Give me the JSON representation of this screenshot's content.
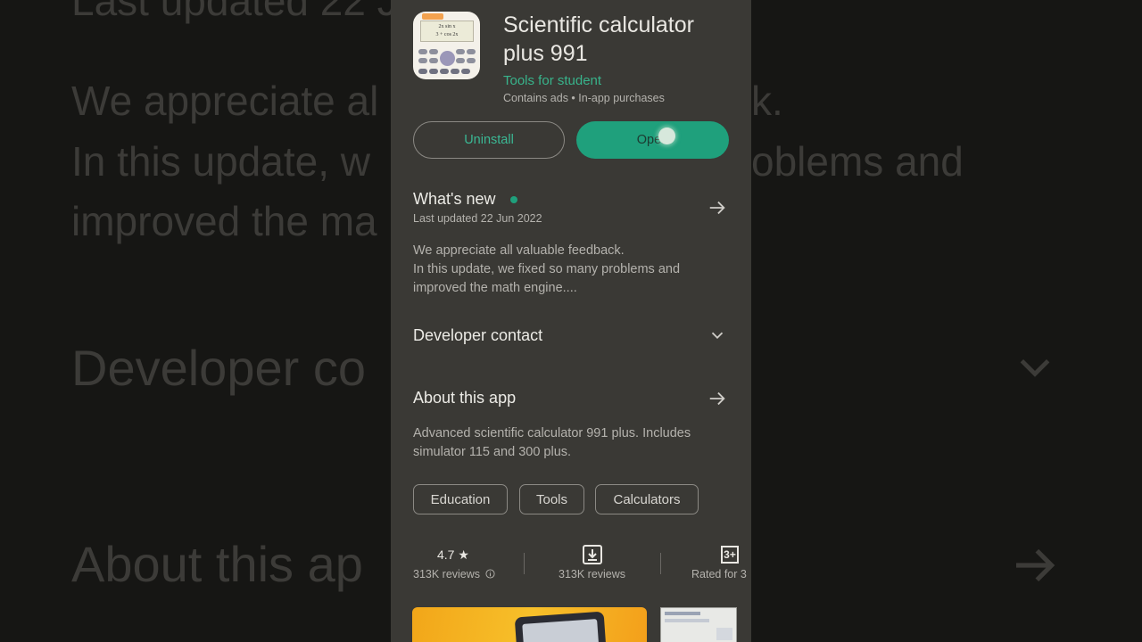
{
  "background": {
    "line1": "Last updated 22 Ju",
    "line2": "We appreciate al",
    "line2b": "k.",
    "line3": "In this update, w",
    "line3b": "oblems and",
    "line4": "improved the ma",
    "line5": "Developer co",
    "line6": "About this ap"
  },
  "app": {
    "title": "Scientific calculator plus 991",
    "developer": "Tools for student",
    "meta": "Contains ads • In-app purchases",
    "icon_formula_top": "2x sin x",
    "icon_formula_bottom": "3 + cos 2x"
  },
  "actions": {
    "uninstall_label": "Uninstall",
    "open_label": "Open"
  },
  "whats_new": {
    "title": "What's new",
    "updated": "Last updated 22 Jun 2022",
    "text_line1": "We appreciate all valuable feedback.",
    "text_line2": "In this update, we fixed so many problems and",
    "text_line3": "improved the math engine...."
  },
  "developer_contact": {
    "title": "Developer contact"
  },
  "about": {
    "title": "About this app",
    "text_line1": "Advanced scientific calculator 991 plus. Includes",
    "text_line2": "simulator 115 and 300 plus."
  },
  "tags": [
    "Education",
    "Tools",
    "Calculators"
  ],
  "stats": {
    "rating_value": "4.7",
    "rating_star": "★",
    "rating_reviews": "313K reviews",
    "downloads_label": "313K reviews",
    "content_rating_box": "3+",
    "content_rating_label": "Rated for 3"
  },
  "colors": {
    "accent": "#1fa07c",
    "panel": "#3a3935",
    "text_primary": "#e9e7e2",
    "text_secondary": "#b4b2ad"
  },
  "icons": [
    "arrow-right-icon",
    "chevron-down-icon",
    "download-icon",
    "info-icon",
    "star-icon"
  ]
}
